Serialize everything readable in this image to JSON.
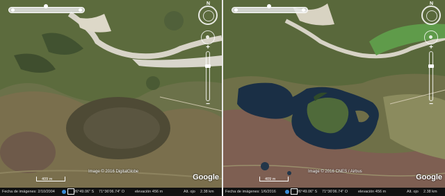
{
  "left_pane": {
    "copyright": "Image © 2016 DigitalGlobe",
    "scale_label": "409 m",
    "logo": "Google",
    "status": {
      "imagery_date": "Fecha de imágenes: 2/10/2004",
      "lat": "26°49.06\" S",
      "lon": "71°36'06.74\" O",
      "elevation": "elevación   456 m",
      "altitude": "Alt. ojo",
      "eye_alt": "2.38 km"
    }
  },
  "right_pane": {
    "copyright": "Image © 2016 CNES / Airbus",
    "scale_label": "409 m",
    "logo": "Google",
    "status": {
      "imagery_date": "Fecha de imágenes: 1/6/2016",
      "lat": "26°49.06\" S",
      "lon": "71°36'06.74\" O",
      "elevation": "elevación   456 m",
      "altitude": "Alt. ojo",
      "eye_alt": "2.38 km"
    }
  },
  "icons": {
    "compass": "compass-icon",
    "look": "look-joystick-icon",
    "zoom_in": "zoom-in-icon",
    "zoom_out": "zoom-out-icon",
    "globe": "globe-icon"
  },
  "controls": {
    "compass_north": "N",
    "zoom_in_glyph": "+",
    "zoom_out_glyph": "−"
  },
  "colors": {
    "water_2016": "#1a2f45",
    "vegetation": "#5f6a43",
    "river_sand": "#d8d4c8"
  }
}
